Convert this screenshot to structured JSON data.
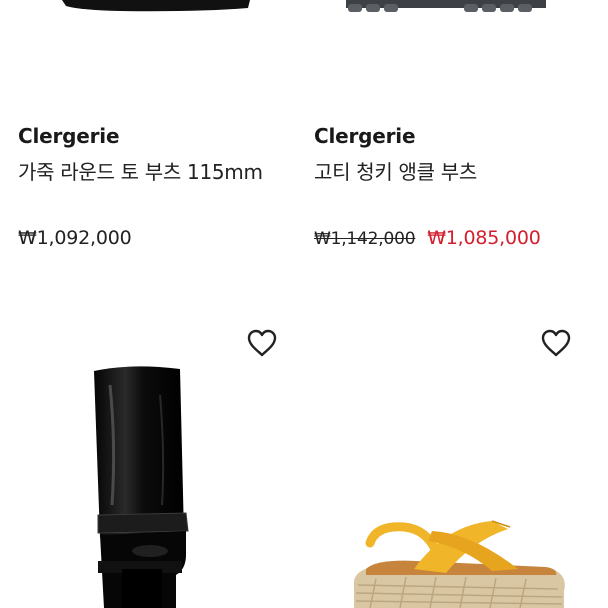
{
  "products_top": [
    {
      "brand": "Clergerie",
      "name": "가죽 라운드 토 부츠 115mm",
      "price": "₩1,092,000"
    },
    {
      "brand": "Clergerie",
      "name": "고티 청키 앵클 부츠",
      "price_original": "₩1,142,000",
      "price_sale": "₩1,085,000"
    }
  ],
  "products_bottom": [
    {
      "image": "black-knee-high-platform-boot",
      "wishlist_icon": "heart-outline-icon"
    },
    {
      "image": "yellow-crossover-espadrille-sandal",
      "wishlist_icon": "heart-outline-icon"
    }
  ],
  "colors": {
    "sale_red": "#d21f2e",
    "text": "#222222",
    "sandal_yellow": "#f1b52a",
    "sole_tan": "#d9c7a3"
  }
}
